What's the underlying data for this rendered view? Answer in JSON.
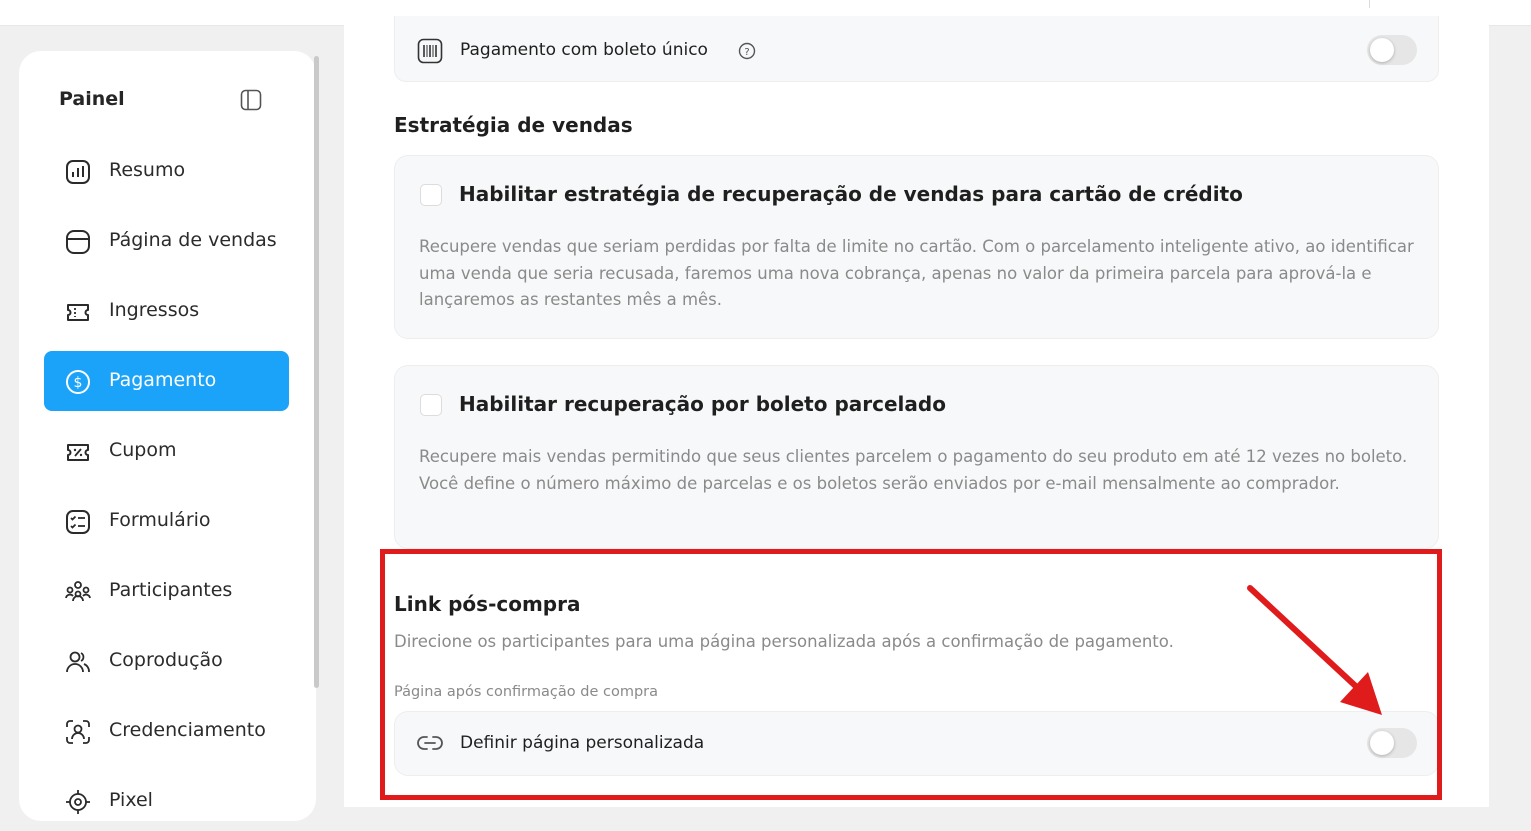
{
  "sidebar": {
    "title": "Painel",
    "items": [
      {
        "label": "Resumo",
        "icon": "chart-icon"
      },
      {
        "label": "Página de vendas",
        "icon": "browser-icon"
      },
      {
        "label": "Ingressos",
        "icon": "ticket-icon"
      },
      {
        "label": "Pagamento",
        "icon": "dollar-icon",
        "active": true
      },
      {
        "label": "Cupom",
        "icon": "coupon-icon"
      },
      {
        "label": "Formulário",
        "icon": "form-icon"
      },
      {
        "label": "Participantes",
        "icon": "people-icon"
      },
      {
        "label": "Coprodução",
        "icon": "users-icon"
      },
      {
        "label": "Credenciamento",
        "icon": "scan-user-icon"
      },
      {
        "label": "Pixel",
        "icon": "pixel-icon"
      }
    ]
  },
  "main": {
    "boleto_unico": {
      "label": "Pagamento com boleto único",
      "enabled": false
    },
    "sales_strategy": {
      "title": "Estratégia de vendas",
      "credit_card_recovery": {
        "title": "Habilitar estratégia de recuperação de vendas para cartão de crédito",
        "description": "Recupere vendas que seriam perdidas por falta de limite no cartão. Com o parcelamento inteligente ativo, ao identificar uma venda que seria recusada, faremos uma nova cobrança, apenas no valor da primeira parcela para aprová-la e lançaremos as restantes mês a mês.",
        "checked": false
      },
      "boleto_recovery": {
        "title": "Habilitar recuperação por boleto parcelado",
        "description": "Recupere mais vendas permitindo que seus clientes parcelem o pagamento do seu produto em até 12 vezes no boleto. Você define o número máximo de parcelas e os boletos serão enviados por e-mail mensalmente ao comprador.",
        "checked": false
      }
    },
    "post_purchase": {
      "title": "Link pós-compra",
      "description": "Direcione os participantes para uma página personalizada após a confirmação de pagamento.",
      "field_label": "Página após confirmação de compra",
      "option_label": "Definir página personalizada",
      "enabled": false
    }
  },
  "colors": {
    "accent": "#1aa3f9",
    "highlight": "#e01b1b"
  }
}
